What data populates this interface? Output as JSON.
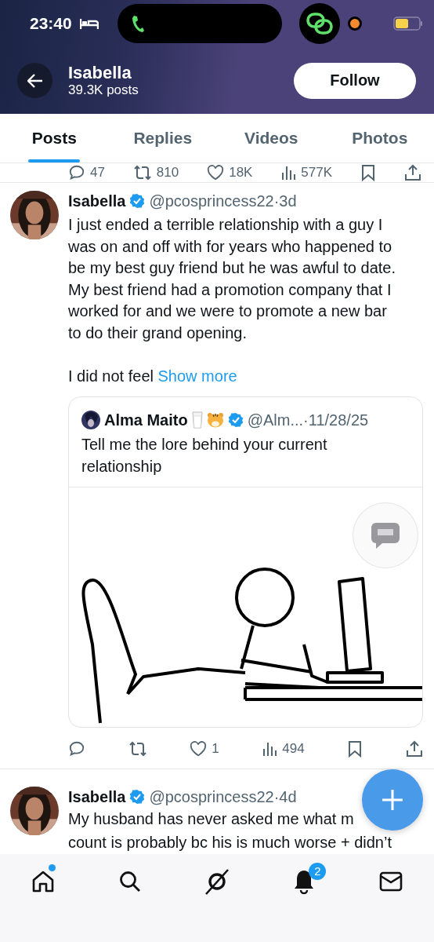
{
  "status_bar": {
    "time": "23:40"
  },
  "header": {
    "name": "Isabella",
    "subtitle": "39.3K posts",
    "follow_label": "Follow"
  },
  "tabs": [
    {
      "label": "Posts",
      "selected": true
    },
    {
      "label": "Replies",
      "selected": false
    },
    {
      "label": "Videos",
      "selected": false
    },
    {
      "label": "Photos",
      "selected": false
    }
  ],
  "previous_post_actions": [
    {
      "kind": "reply",
      "count": "47"
    },
    {
      "kind": "repost",
      "count": "810"
    },
    {
      "kind": "like",
      "count": "18K"
    },
    {
      "kind": "views",
      "count": "577K"
    },
    {
      "kind": "bookmark"
    },
    {
      "kind": "share"
    }
  ],
  "posts": [
    {
      "name": "Isabella",
      "verified": true,
      "meta": "@pcosprincess22·3d",
      "text": "I just ended a terrible relationship with a guy I\nwas on and off with for years who happened to\nbe my best guy friend but he was awful to date.\nMy best friend had a promotion company that I\nworked for and we were to promote a new bar\nto do their grand opening.\n\nI did not feel",
      "show_more": "Show more",
      "quote": {
        "name": "Alma Maito",
        "verified": true,
        "meta": "@Alm...·11/28/25",
        "text": "Tell me the lore behind your current\nrelationship"
      },
      "actions": [
        {
          "kind": "reply"
        },
        {
          "kind": "repost"
        },
        {
          "kind": "like",
          "count": "1"
        },
        {
          "kind": "views",
          "count": "494"
        },
        {
          "kind": "bookmark"
        },
        {
          "kind": "share"
        }
      ]
    },
    {
      "name": "Isabella",
      "verified": true,
      "meta": "@pcosprincess22·4d",
      "text": "My husband has never asked me what m\ncount is probably bc his is much worse + didn’t"
    }
  ],
  "bottom_nav": [
    {
      "kind": "home",
      "dot": true
    },
    {
      "kind": "search"
    },
    {
      "kind": "grok"
    },
    {
      "kind": "notifications",
      "badge": "2"
    },
    {
      "kind": "messages"
    }
  ]
}
